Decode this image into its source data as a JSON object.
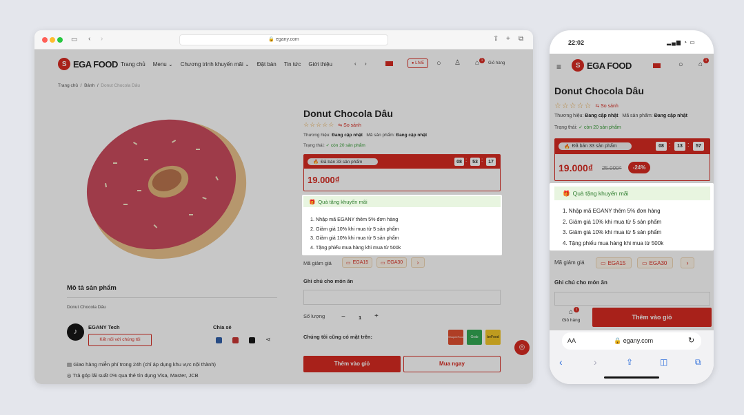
{
  "desktop": {
    "url": "egany.com",
    "brand": "EGA FOOD",
    "nav": [
      "Trang chủ",
      "Menu",
      "Chương trình khuyến mãi",
      "Đặt bàn",
      "Tin tức",
      "Giới thiệu"
    ],
    "live_label": "LIVE",
    "cart_count": "1",
    "cart_label": "Giỏ hàng",
    "breadcrumb": [
      "Trang chủ",
      "Bánh",
      "Donut Chocola Dâu"
    ],
    "product": {
      "title": "Donut Chocola Dâu",
      "compare": "So sánh",
      "brand_label": "Thương hiệu:",
      "brand_value": "Đang cập nhật",
      "sku_label": "Mã sản phẩm:",
      "sku_value": "Đang cập nhật",
      "status_label": "Trạng thái:",
      "status_value": "còn 20 sản phẩm",
      "sold": "Đã bán 33 sản phẩm",
      "timer": [
        "08",
        "53",
        "17"
      ],
      "price": "19.000₫"
    },
    "promo": {
      "heading": "Quà tặng khuyến mãi",
      "items": [
        "1. Nhập mã EGANY thêm 5% đơn hàng",
        "2. Giảm giá 10% khi mua từ 5 sản phẩm",
        "3. Giảm giá 10% khi mua từ 5 sản phẩm",
        "4. Tặng phiếu mua hàng khi mua từ 500k"
      ]
    },
    "coupon_label": "Mã giảm giá",
    "coupons": [
      "EGA15",
      "EGA30"
    ],
    "note_label": "Ghi chú cho món ăn",
    "qty_label": "Số lượng",
    "qty_value": "1",
    "also_label": "Chúng tôi cũng có mặt trên:",
    "apps": [
      "ShopeeFood",
      "Grab Food",
      "beFood"
    ],
    "add_cart": "Thêm vào giỏ",
    "buy_now": "Mua ngay",
    "desc_heading": "Mô tả sản phẩm",
    "desc_text": "Donut Chocola Dâu",
    "seller": "EGANY Tech",
    "connect": "Kết nối với chúng tôi",
    "share": "Chia sẻ",
    "policies": [
      "Giao hàng miễn phí trong 24h (chỉ áp dụng khu vực nội thành)",
      "Trả góp lãi suất 0% qua thẻ tín dụng Visa, Master, JCB"
    ]
  },
  "mobile": {
    "time": "22:02",
    "brand": "EGA FOOD",
    "cart_count": "1",
    "product": {
      "title": "Donut Chocola Dâu",
      "compare": "So sánh",
      "brand_label": "Thương hiệu:",
      "brand_value": "Đang cập nhật",
      "sku_label": "Mã sản phẩm:",
      "sku_value": "Đang cập nhật",
      "status_label": "Trạng thái:",
      "status_value": "còn 20 sản phẩm",
      "sold": "Đã bán 33 sản phẩm",
      "timer": [
        "08",
        "13",
        "57"
      ],
      "price": "19.000₫",
      "old_price": "25.000₫",
      "discount": "-24%"
    },
    "promo": {
      "heading": "Quà tặng khuyến mãi",
      "items": [
        "1. Nhập mã EGANY thêm 5% đơn hàng",
        "2. Giảm giá 10% khi mua từ 5 sản phẩm",
        "3. Giảm giá 10% khi mua từ 5 sản phẩm",
        "4. Tặng phiếu mua hàng khi mua từ 500k"
      ]
    },
    "coupon_label": "Mã giảm giá",
    "coupons": [
      "EGA15",
      "EGA30"
    ],
    "note_label": "Ghi chú cho món ăn",
    "cart_label": "Giỏ hàng",
    "add_cart": "Thêm vào giỏ",
    "aa": "AA",
    "url": "egany.com"
  },
  "colors": {
    "brand_red": "#d7261c",
    "promo_green": "#2f7d2f",
    "star": "#e6a23c"
  }
}
